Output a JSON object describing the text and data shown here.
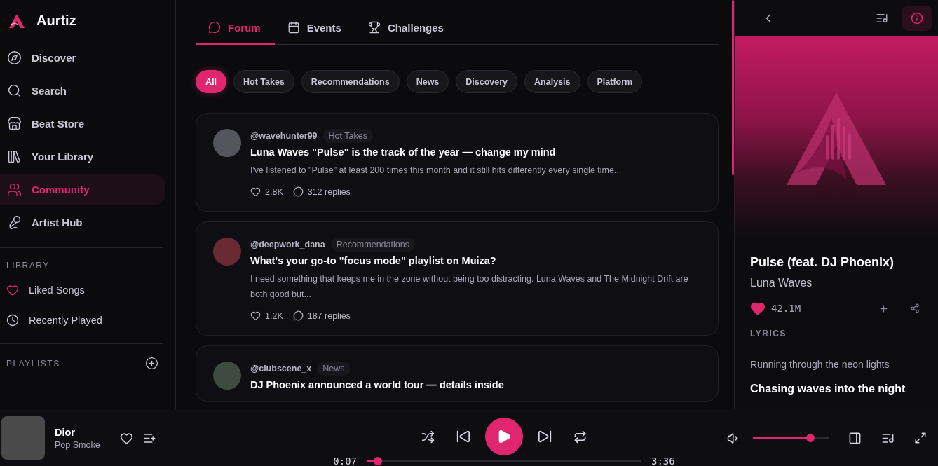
{
  "brand": {
    "name": "Aurtiz"
  },
  "nav": [
    {
      "label": "Discover",
      "selected": false
    },
    {
      "label": "Search",
      "selected": false
    },
    {
      "label": "Beat Store",
      "selected": false
    },
    {
      "label": "Your Library",
      "selected": false
    },
    {
      "label": "Community",
      "selected": true
    },
    {
      "label": "Artist Hub",
      "selected": false
    }
  ],
  "library": {
    "heading": "LIBRARY",
    "items": [
      {
        "label": "Liked Songs"
      },
      {
        "label": "Recently Played"
      }
    ]
  },
  "playlists": {
    "heading": "PLAYLISTS"
  },
  "tabs": [
    {
      "label": "Forum",
      "selected": true
    },
    {
      "label": "Events",
      "selected": false
    },
    {
      "label": "Challenges",
      "selected": false
    }
  ],
  "filters": [
    {
      "label": "All",
      "selected": true
    },
    {
      "label": "Hot Takes",
      "selected": false
    },
    {
      "label": "Recommendations",
      "selected": false
    },
    {
      "label": "News",
      "selected": false
    },
    {
      "label": "Discovery",
      "selected": false
    },
    {
      "label": "Analysis",
      "selected": false
    },
    {
      "label": "Platform",
      "selected": false
    }
  ],
  "posts": [
    {
      "user": "@wavehunter99",
      "tag": "Hot Takes",
      "title": "Luna Waves \"Pulse\" is the track of the year — change my mind",
      "body": "I've listened to \"Pulse\" at least 200 times this month and it still hits differently every single time...",
      "likes": "2.8K",
      "replies": "312 replies"
    },
    {
      "user": "@deepwork_dana",
      "tag": "Recommendations",
      "title": "What's your go-to \"focus mode\" playlist on Muiza?",
      "body": "I need something that keeps me in the zone without being too distracting. Luna Waves and The Midnight Drift are both good but...",
      "likes": "1.2K",
      "replies": "187 replies"
    },
    {
      "user": "@clubscene_x",
      "tag": "News",
      "title": "DJ Phoenix announced a world tour — details inside"
    }
  ],
  "now_playing": {
    "title": "Pulse (feat. DJ Phoenix)",
    "artist": "Luna Waves",
    "likes": "42.1M",
    "lyrics_heading": "LYRICS",
    "lyrics": [
      {
        "text": "Running through the neon lights",
        "active": false
      },
      {
        "text": "Chasing waves into the night",
        "active": true
      }
    ]
  },
  "player": {
    "title": "Dior",
    "artist": "Pop Smoke",
    "elapsed": "0:07",
    "duration": "3:36",
    "progress": {
      "level": 0.04
    },
    "volume": {
      "level": 0.76
    }
  }
}
